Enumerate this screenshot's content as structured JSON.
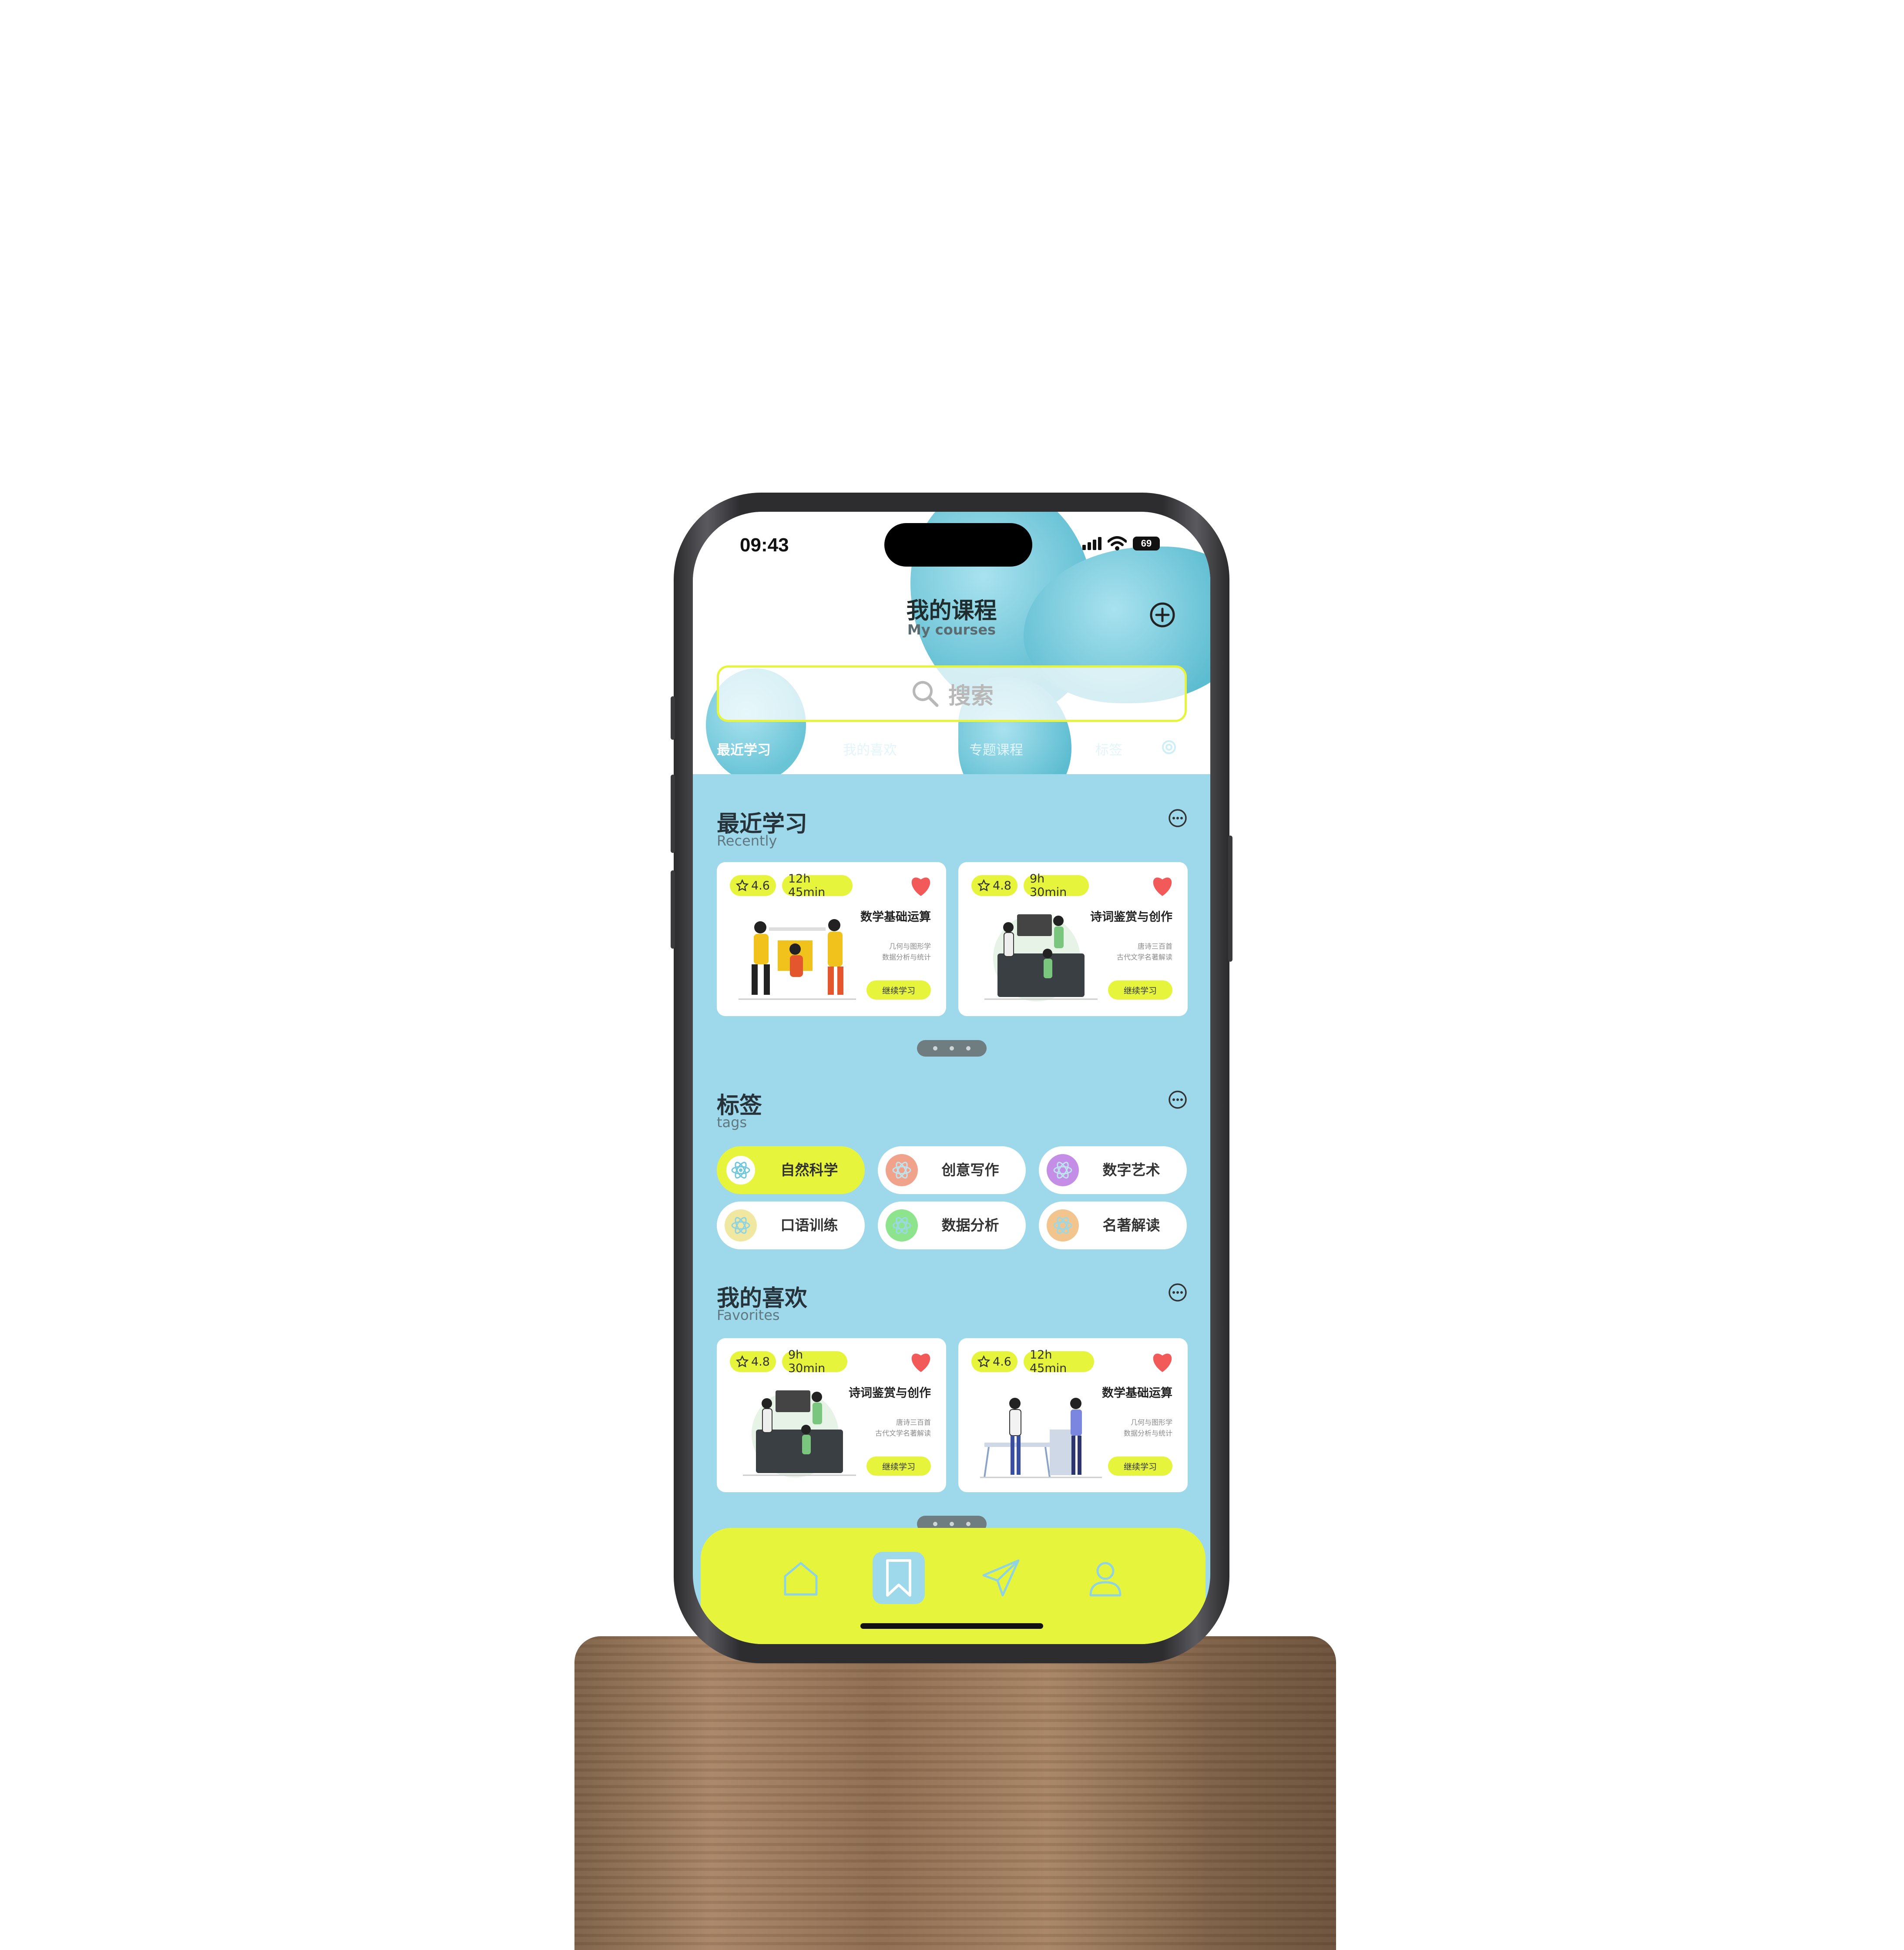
{
  "status": {
    "time": "09:43",
    "battery": "69"
  },
  "header": {
    "title": "我的课程",
    "subtitle": "My courses"
  },
  "search": {
    "placeholder": "搜索"
  },
  "tabs": [
    {
      "label": "最近学习"
    },
    {
      "label": "我的喜欢"
    },
    {
      "label": "专题课程"
    },
    {
      "label": "标签"
    }
  ],
  "recent": {
    "title": "最近学习",
    "subtitle": "Recently",
    "cards": [
      {
        "rating": "4.6",
        "duration": "12h 45min",
        "name": "数学基础运算",
        "line1": "几何与图形学",
        "line2": "数据分析与统计",
        "action": "继续学习"
      },
      {
        "rating": "4.8",
        "duration": "9h 30min",
        "name": "诗词鉴赏与创作",
        "line1": "唐诗三百首",
        "line2": "古代文学名著解读",
        "action": "继续学习"
      }
    ]
  },
  "tags": {
    "title": "标签",
    "subtitle": "tags",
    "items": [
      {
        "label": "自然科学",
        "color": "#ffffff"
      },
      {
        "label": "创意写作",
        "color": "#f0a38a"
      },
      {
        "label": "数字艺术",
        "color": "#c58ee6"
      },
      {
        "label": "口语训练",
        "color": "#f0e8a0"
      },
      {
        "label": "数据分析",
        "color": "#8de48d"
      },
      {
        "label": "名著解读",
        "color": "#f2c58f"
      }
    ]
  },
  "favorites": {
    "title": "我的喜欢",
    "subtitle": "Favorites",
    "cards": [
      {
        "rating": "4.8",
        "duration": "9h 30min",
        "name": "诗词鉴赏与创作",
        "line1": "唐诗三百首",
        "line2": "古代文学名著解读",
        "action": "继续学习"
      },
      {
        "rating": "4.6",
        "duration": "12h 45min",
        "name": "数学基础运算",
        "line1": "几何与图形学",
        "line2": "数据分析与统计",
        "action": "继续学习"
      }
    ]
  },
  "colors": {
    "accent": "#e6f53c",
    "screen_bg": "#9dd9eb",
    "heart": "#f25a5a"
  },
  "nav": [
    "home-icon",
    "bookmark-icon",
    "send-icon",
    "profile-icon"
  ]
}
